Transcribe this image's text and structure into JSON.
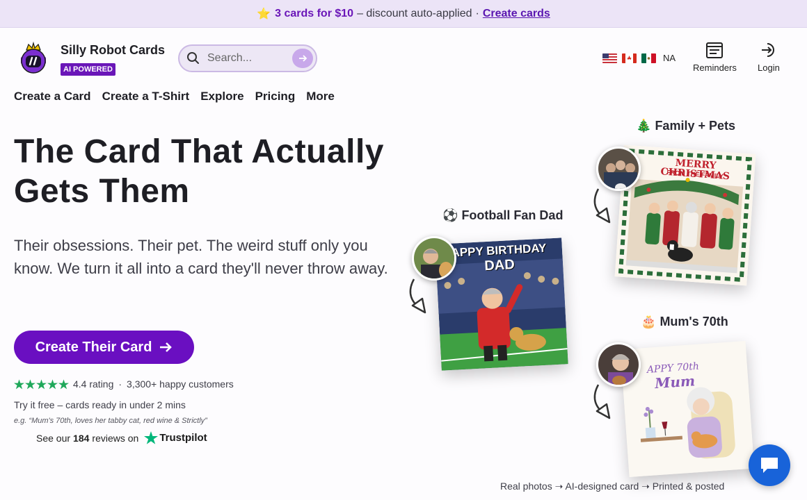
{
  "promo": {
    "star": "⭐",
    "deal": "3 cards for $10",
    "text": "– discount auto-applied",
    "separator": "·",
    "cta": "Create cards"
  },
  "header": {
    "brand": "Silly Robot Cards",
    "badge": "AI POWERED",
    "search_placeholder": "Search...",
    "region_label": "NA",
    "reminders": "Reminders",
    "login": "Login"
  },
  "nav": [
    "Create a Card",
    "Create a T-Shirt",
    "Explore",
    "Pricing",
    "More"
  ],
  "hero": {
    "title": "The Card That Actually Gets Them",
    "subtitle": "Their obsessions. Their pet. The weird stuff only you know. We turn it all into a card they'll never throw away.",
    "cta": "Create Their Card",
    "rating": "4.4 rating",
    "rating_sep": "·",
    "customers": "3,300+ happy customers",
    "try": "Try it free – cards ready in under 2 mins",
    "example": "e.g. “Mum's 70th, loves her tabby cat, red wine & Strictly”",
    "trustpilot_pre": "See our",
    "trustpilot_count": "184",
    "trustpilot_post": "reviews on",
    "trustpilot_brand": "Trustpilot",
    "stars": 5,
    "rating_value": 4.4
  },
  "examples": [
    {
      "emoji": "🎄",
      "label": "Family + Pets",
      "card_line1": "MERRY CHRISTMAS",
      "card_line2": "FROM THE FAMILY"
    },
    {
      "emoji": "⚽",
      "label": "Football Fan Dad",
      "card_line1": "APPY BIRTHDAY",
      "card_line2": "DAD"
    },
    {
      "emoji": "🎂",
      "label": "Mum's 70th",
      "card_line1": "APPY 70th",
      "card_line2": "Mum"
    }
  ],
  "footer_note": "Real photos ➝ AI-designed card ➝ Printed & posted",
  "colors": {
    "brand_purple": "#6a0fc1",
    "promo_bg": "#ece4f7",
    "chat_blue": "#1863d9",
    "trustpilot_green": "#00b67a"
  }
}
